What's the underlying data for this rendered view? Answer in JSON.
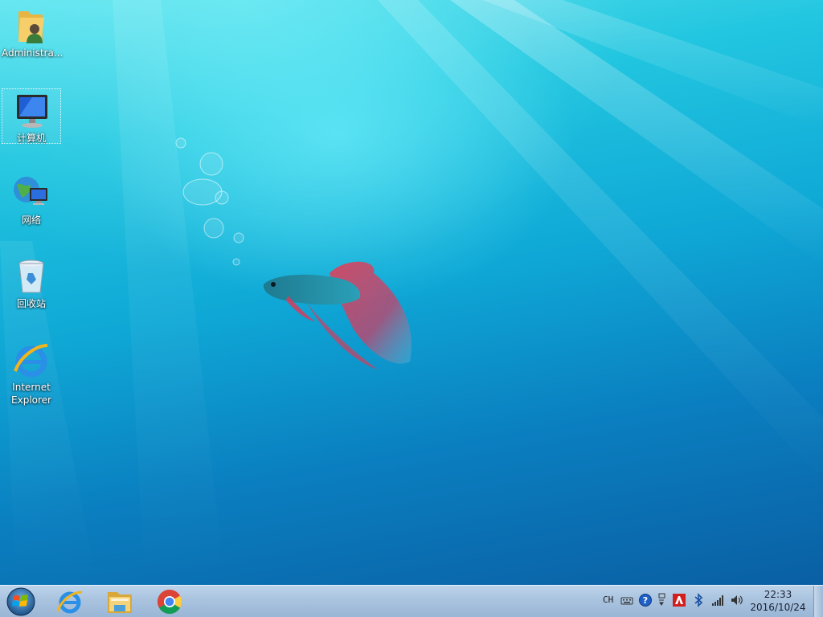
{
  "desktop": {
    "icons": [
      {
        "label": "Administra..."
      },
      {
        "label": "计算机"
      },
      {
        "label": "网络"
      },
      {
        "label": "回收站"
      },
      {
        "label": "Internet Explorer"
      }
    ],
    "selected_icon": "计算机"
  },
  "taskbar": {
    "start_icon": "windows-orb-icon",
    "pinned": [
      {
        "icon": "internet-explorer-icon"
      },
      {
        "icon": "file-explorer-icon"
      },
      {
        "icon": "chrome-icon"
      }
    ],
    "tray": {
      "language": "CH",
      "icons": [
        "keyboard-icon",
        "help-icon",
        "network-adapter-icon",
        "avira-icon",
        "bluetooth-icon",
        "signal-icon",
        "volume-icon"
      ]
    },
    "clock": {
      "time": "22:33",
      "date": "2016/10/24"
    }
  },
  "colors": {
    "taskbar": "#a9c3df",
    "desktop_top": "#5ee3ee",
    "desktop_bottom": "#0a5fa3"
  }
}
